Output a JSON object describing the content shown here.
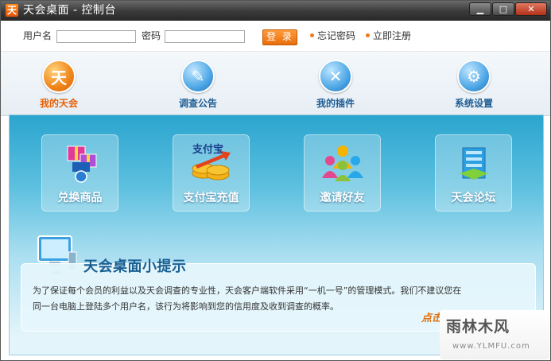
{
  "window": {
    "app_icon_glyph": "天",
    "title": "天会桌面 - 控制台",
    "minimize_glyph": "▁",
    "maximize_glyph": "□",
    "close_glyph": "✕"
  },
  "login": {
    "username_label": "用户名",
    "username_value": "",
    "password_label": "密码",
    "password_value": "",
    "login_button": "登 录",
    "forgot_link": "忘记密码",
    "register_link": "立即注册"
  },
  "nav": {
    "items": [
      {
        "label": "我的天会",
        "icon": "tianhui-logo-icon",
        "glyph": "天",
        "active": true
      },
      {
        "label": "调查公告",
        "icon": "pencil-icon",
        "glyph": "✎",
        "active": false
      },
      {
        "label": "我的插件",
        "icon": "tools-icon",
        "glyph": "✕",
        "active": false
      },
      {
        "label": "系统设置",
        "icon": "gear-icon",
        "glyph": "⚙",
        "active": false
      }
    ]
  },
  "tiles": [
    {
      "label": "兑换商品",
      "icon": "gift-icon"
    },
    {
      "label": "支付宝充值",
      "icon": "alipay-coins-icon",
      "art_text": "支付宝"
    },
    {
      "label": "邀请好友",
      "icon": "friends-icon"
    },
    {
      "label": "天会论坛",
      "icon": "forum-icon"
    }
  ],
  "tips": {
    "title": "天会桌面小提示",
    "line1": "为了保证每个会员的利益以及天会调查的专业性，天会客户端软件采用“一机一号”的管理模式。我们不建议您在",
    "line2": "同一台电脑上登陆多个用户名，该行为将影响到您的信用度及收到调查的概率。",
    "more_link": "点击"
  },
  "watermark": {
    "main": "雨林木风",
    "sub": "www.YLMFU.com"
  },
  "colors": {
    "accent_orange": "#f08418",
    "nav_blue": "#1e5e96",
    "content_top": "#2ba5cf"
  }
}
